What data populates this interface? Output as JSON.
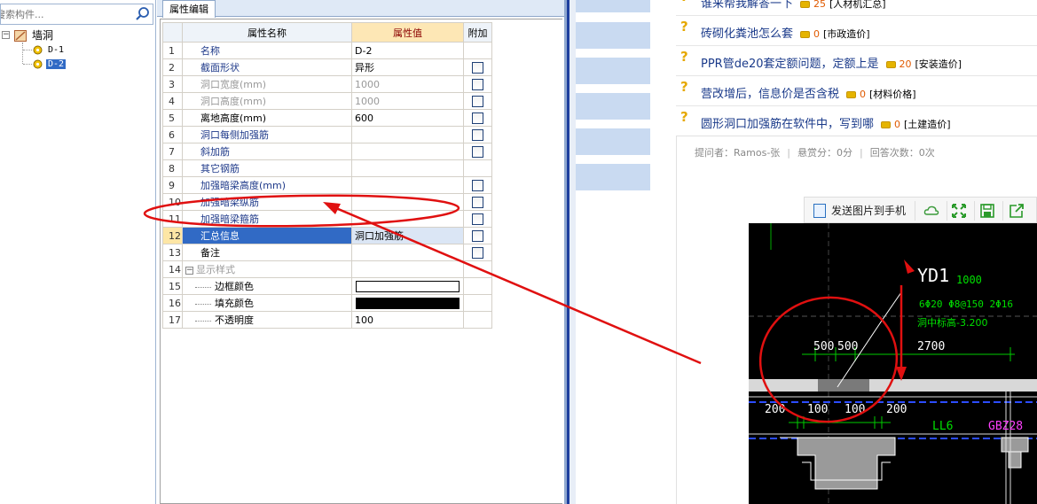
{
  "tree": {
    "search_placeholder": "搜索构件...",
    "root_label": "墙洞",
    "root_expander": "−",
    "items": [
      {
        "label": "D-1",
        "selected": false
      },
      {
        "label": "D-2",
        "selected": true
      }
    ]
  },
  "property_editor": {
    "tab_label": "属性编辑",
    "headers": {
      "name": "属性名称",
      "value": "属性值",
      "extra": "附加"
    },
    "rows": [
      {
        "num": "1",
        "name": "名称",
        "value": "D-2",
        "check": false,
        "style": "link"
      },
      {
        "num": "2",
        "name": "截面形状",
        "value": "异形",
        "check": true,
        "style": "link"
      },
      {
        "num": "3",
        "name": "洞口宽度(mm)",
        "value": "1000",
        "check": true,
        "style": "gray"
      },
      {
        "num": "4",
        "name": "洞口高度(mm)",
        "value": "1000",
        "check": true,
        "style": "gray"
      },
      {
        "num": "5",
        "name": "离地高度(mm)",
        "value": "600",
        "check": true,
        "style": "black"
      },
      {
        "num": "6",
        "name": "洞口每侧加强筋",
        "value": "",
        "check": true,
        "style": "link"
      },
      {
        "num": "7",
        "name": "斜加筋",
        "value": "",
        "check": true,
        "style": "link"
      },
      {
        "num": "8",
        "name": "其它钢筋",
        "value": "",
        "check": false,
        "style": "link"
      },
      {
        "num": "9",
        "name": "加强暗梁高度(mm)",
        "value": "",
        "check": true,
        "style": "link"
      },
      {
        "num": "10",
        "name": "加强暗梁纵筋",
        "value": "",
        "check": true,
        "style": "link"
      },
      {
        "num": "11",
        "name": "加强暗梁箍筋",
        "value": "",
        "check": true,
        "style": "link"
      },
      {
        "num": "12",
        "name": "汇总信息",
        "value": "洞口加强筋",
        "check": true,
        "style": "selected"
      },
      {
        "num": "13",
        "name": "备注",
        "value": "",
        "check": true,
        "style": "black"
      },
      {
        "num": "14",
        "name": "显示样式",
        "value": "",
        "check": false,
        "style": "group"
      },
      {
        "num": "15",
        "name": "边框颜色",
        "value": "",
        "check": false,
        "style": "sub",
        "swatch": "#ffffff"
      },
      {
        "num": "16",
        "name": "填充颜色",
        "value": "",
        "check": false,
        "style": "sub",
        "swatch": "#000000"
      },
      {
        "num": "17",
        "name": "不透明度",
        "value": "100",
        "check": false,
        "style": "sub"
      }
    ],
    "group_expander": "−"
  },
  "qa_list": [
    {
      "title": "谁来帮我解答一下",
      "score": "25",
      "category": "[人材机汇总]"
    },
    {
      "title": "砖砌化粪池怎么套",
      "score": "0",
      "category": "[市政造价]"
    },
    {
      "title": "PPR管de20套定额问题，定额上是",
      "score": "20",
      "category": "[安装造价]"
    },
    {
      "title": "营改增后，信息价是否含税",
      "score": "0",
      "category": "[材料价格]"
    },
    {
      "title": "圆形洞口加强筋在软件中，写到哪",
      "score": "0",
      "category": "[土建造价]"
    }
  ],
  "qa_mark": "?",
  "question_meta": {
    "asker": "提问者：Ramos-张",
    "reward": "悬赏分：0分",
    "answers": "回答次数：0次",
    "separator": "|"
  },
  "image_toolbar": {
    "send_label": "发送图片到手机",
    "icons": [
      "cloud-icon",
      "expand-icon",
      "save-icon",
      "share-icon"
    ]
  },
  "cad": {
    "title": "YD1",
    "title_value": "1000",
    "rebar_text": "6Φ20  Φ8@150  2Φ16",
    "elev_text": "洞中标高-3.200",
    "dims_top": [
      "500",
      "500",
      "2700"
    ],
    "dims_bottom": [
      "200",
      "100",
      "100",
      "200"
    ],
    "beam_label": "LL6",
    "col_label": "GBZ28"
  },
  "colors": {
    "annotation_red": "#e01010",
    "selection_blue": "#316ac5",
    "link_blue": "#1f3a8a",
    "cad_green": "#00e000",
    "cad_magenta": "#ff40ff"
  }
}
